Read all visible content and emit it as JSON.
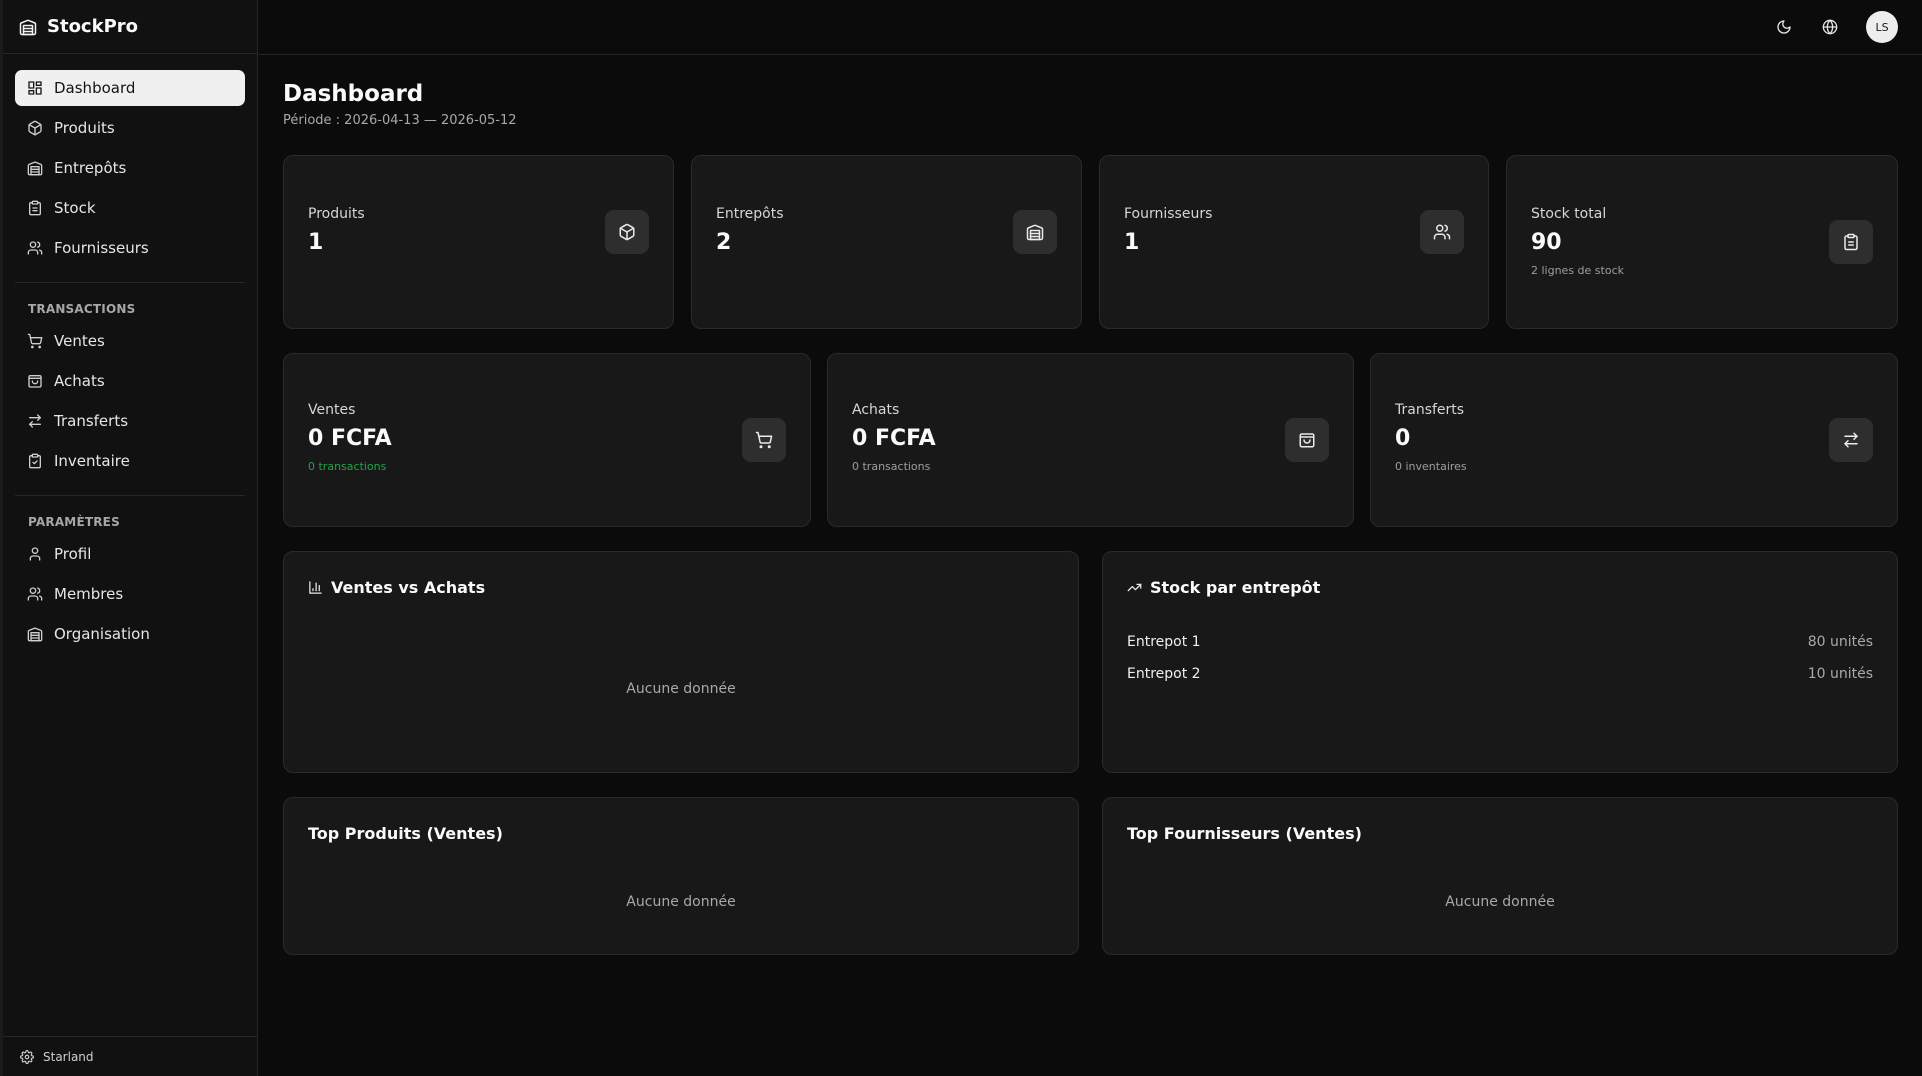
{
  "app": {
    "name": "StockPro"
  },
  "sidebar": {
    "main_items": [
      {
        "label": "Dashboard",
        "icon": "layout-grid-icon",
        "active": true
      },
      {
        "label": "Produits",
        "icon": "package-icon"
      },
      {
        "label": "Entrepôts",
        "icon": "warehouse-icon"
      },
      {
        "label": "Stock",
        "icon": "clipboard-icon"
      },
      {
        "label": "Fournisseurs",
        "icon": "users-icon"
      }
    ],
    "groups": {
      "transactions": {
        "title": "TRANSACTIONS",
        "items": [
          {
            "label": "Ventes",
            "icon": "cart-icon"
          },
          {
            "label": "Achats",
            "icon": "shopping-bag-icon"
          },
          {
            "label": "Transferts",
            "icon": "arrows-swap-icon"
          },
          {
            "label": "Inventaire",
            "icon": "clipboard-check-icon"
          }
        ]
      },
      "parametres": {
        "title": "PARAMÈTRES",
        "items": [
          {
            "label": "Profil",
            "icon": "user-icon"
          },
          {
            "label": "Membres",
            "icon": "users-icon"
          },
          {
            "label": "Organisation",
            "icon": "building-icon"
          }
        ]
      }
    },
    "footer": {
      "label": "Starland",
      "icon": "gear-icon"
    }
  },
  "topbar": {
    "avatar_initials": "LS",
    "icons": [
      "moon-icon",
      "globe-icon"
    ]
  },
  "page": {
    "title": "Dashboard",
    "period": "Période : 2026-04-13 — 2026-05-12"
  },
  "stats_top": [
    {
      "label": "Produits",
      "value": "1",
      "icon": "package-icon"
    },
    {
      "label": "Entrepôts",
      "value": "2",
      "icon": "warehouse-icon"
    },
    {
      "label": "Fournisseurs",
      "value": "1",
      "icon": "users-icon"
    },
    {
      "label": "Stock total",
      "value": "90",
      "note": "2 lignes de stock",
      "icon": "clipboard-icon"
    }
  ],
  "stats_mid": [
    {
      "label": "Ventes",
      "value": "0 FCFA",
      "note": "0 transactions",
      "note_color": "#22a34a",
      "icon": "cart-icon"
    },
    {
      "label": "Achats",
      "value": "0 FCFA",
      "note": "0 transactions",
      "icon": "shopping-bag-icon"
    },
    {
      "label": "Transferts",
      "value": "0",
      "note": "0 inventaires",
      "icon": "arrows-swap-icon"
    }
  ],
  "panels": {
    "sales_vs_purchases": {
      "title": "Ventes vs Achats",
      "icon": "bar-chart-icon",
      "empty": "Aucune donnée"
    },
    "stock_by_warehouse": {
      "title": "Stock par entrepôt",
      "icon": "trending-up-icon",
      "rows": [
        {
          "name": "Entrepot 1",
          "value": "80 unités"
        },
        {
          "name": "Entrepot 2",
          "value": "10 unités"
        }
      ]
    },
    "top_products": {
      "title": "Top Produits (Ventes)",
      "empty": "Aucune donnée"
    },
    "top_suppliers": {
      "title": "Top Fournisseurs (Ventes)",
      "empty": "Aucune donnée"
    }
  },
  "colors": {
    "background": "#0b0b0b",
    "sidebar": "#111111",
    "card": "#181818",
    "border": "#2a2a2a",
    "active_nav": "#f0f0f0",
    "positive": "#22a34a"
  }
}
